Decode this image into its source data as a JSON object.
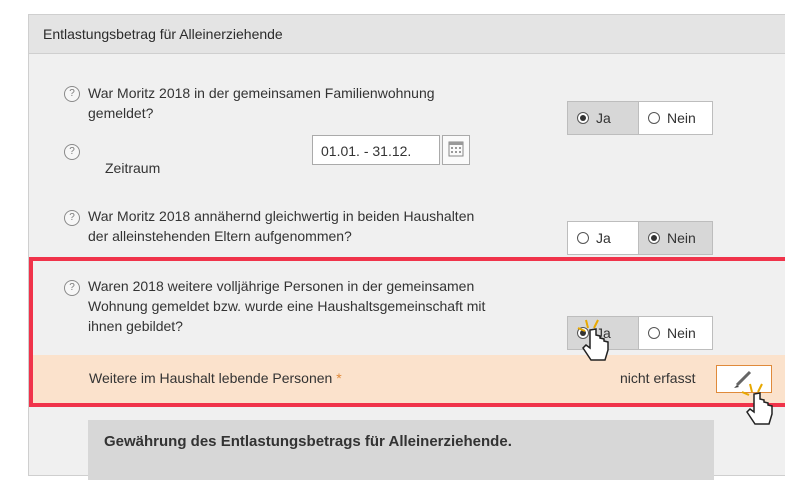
{
  "panel": {
    "title": "Entlastungsbetrag für Alleinerziehende"
  },
  "q1": {
    "help": "?",
    "line1": "War Moritz 2018 in der gemeinsamen Familienwohnung",
    "line2": "gemeldet?",
    "yes": "Ja",
    "no": "Nein",
    "selected": "Ja"
  },
  "zeitraum": {
    "help": "?",
    "label": "Zeitraum",
    "value": "01.01. - 31.12."
  },
  "q2": {
    "help": "?",
    "line1": "War Moritz 2018 annähernd gleichwertig in beiden Haushalten",
    "line2": "der alleinstehenden Eltern aufgenommen?",
    "yes": "Ja",
    "no": "Nein",
    "selected": "Nein"
  },
  "q3": {
    "help": "?",
    "line1": "Waren 2018 weitere volljährige Personen in der gemeinsamen",
    "line2": "Wohnung gemeldet bzw. wurde eine Haushaltsgemeinschaft mit",
    "line3": "ihnen gebildet?",
    "yes": "Ja",
    "no": "Nein",
    "selected": "Ja"
  },
  "persons": {
    "label": "Weitere im Haushalt lebende Personen",
    "required_mark": "*",
    "status": "nicht erfasst"
  },
  "info": {
    "title": "Gewährung des Entlastungsbetrags für Alleinerziehende."
  },
  "colors": {
    "highlight": "#f0334a",
    "subrow_bg": "#fbe2cc",
    "accent": "#e08a3a"
  }
}
